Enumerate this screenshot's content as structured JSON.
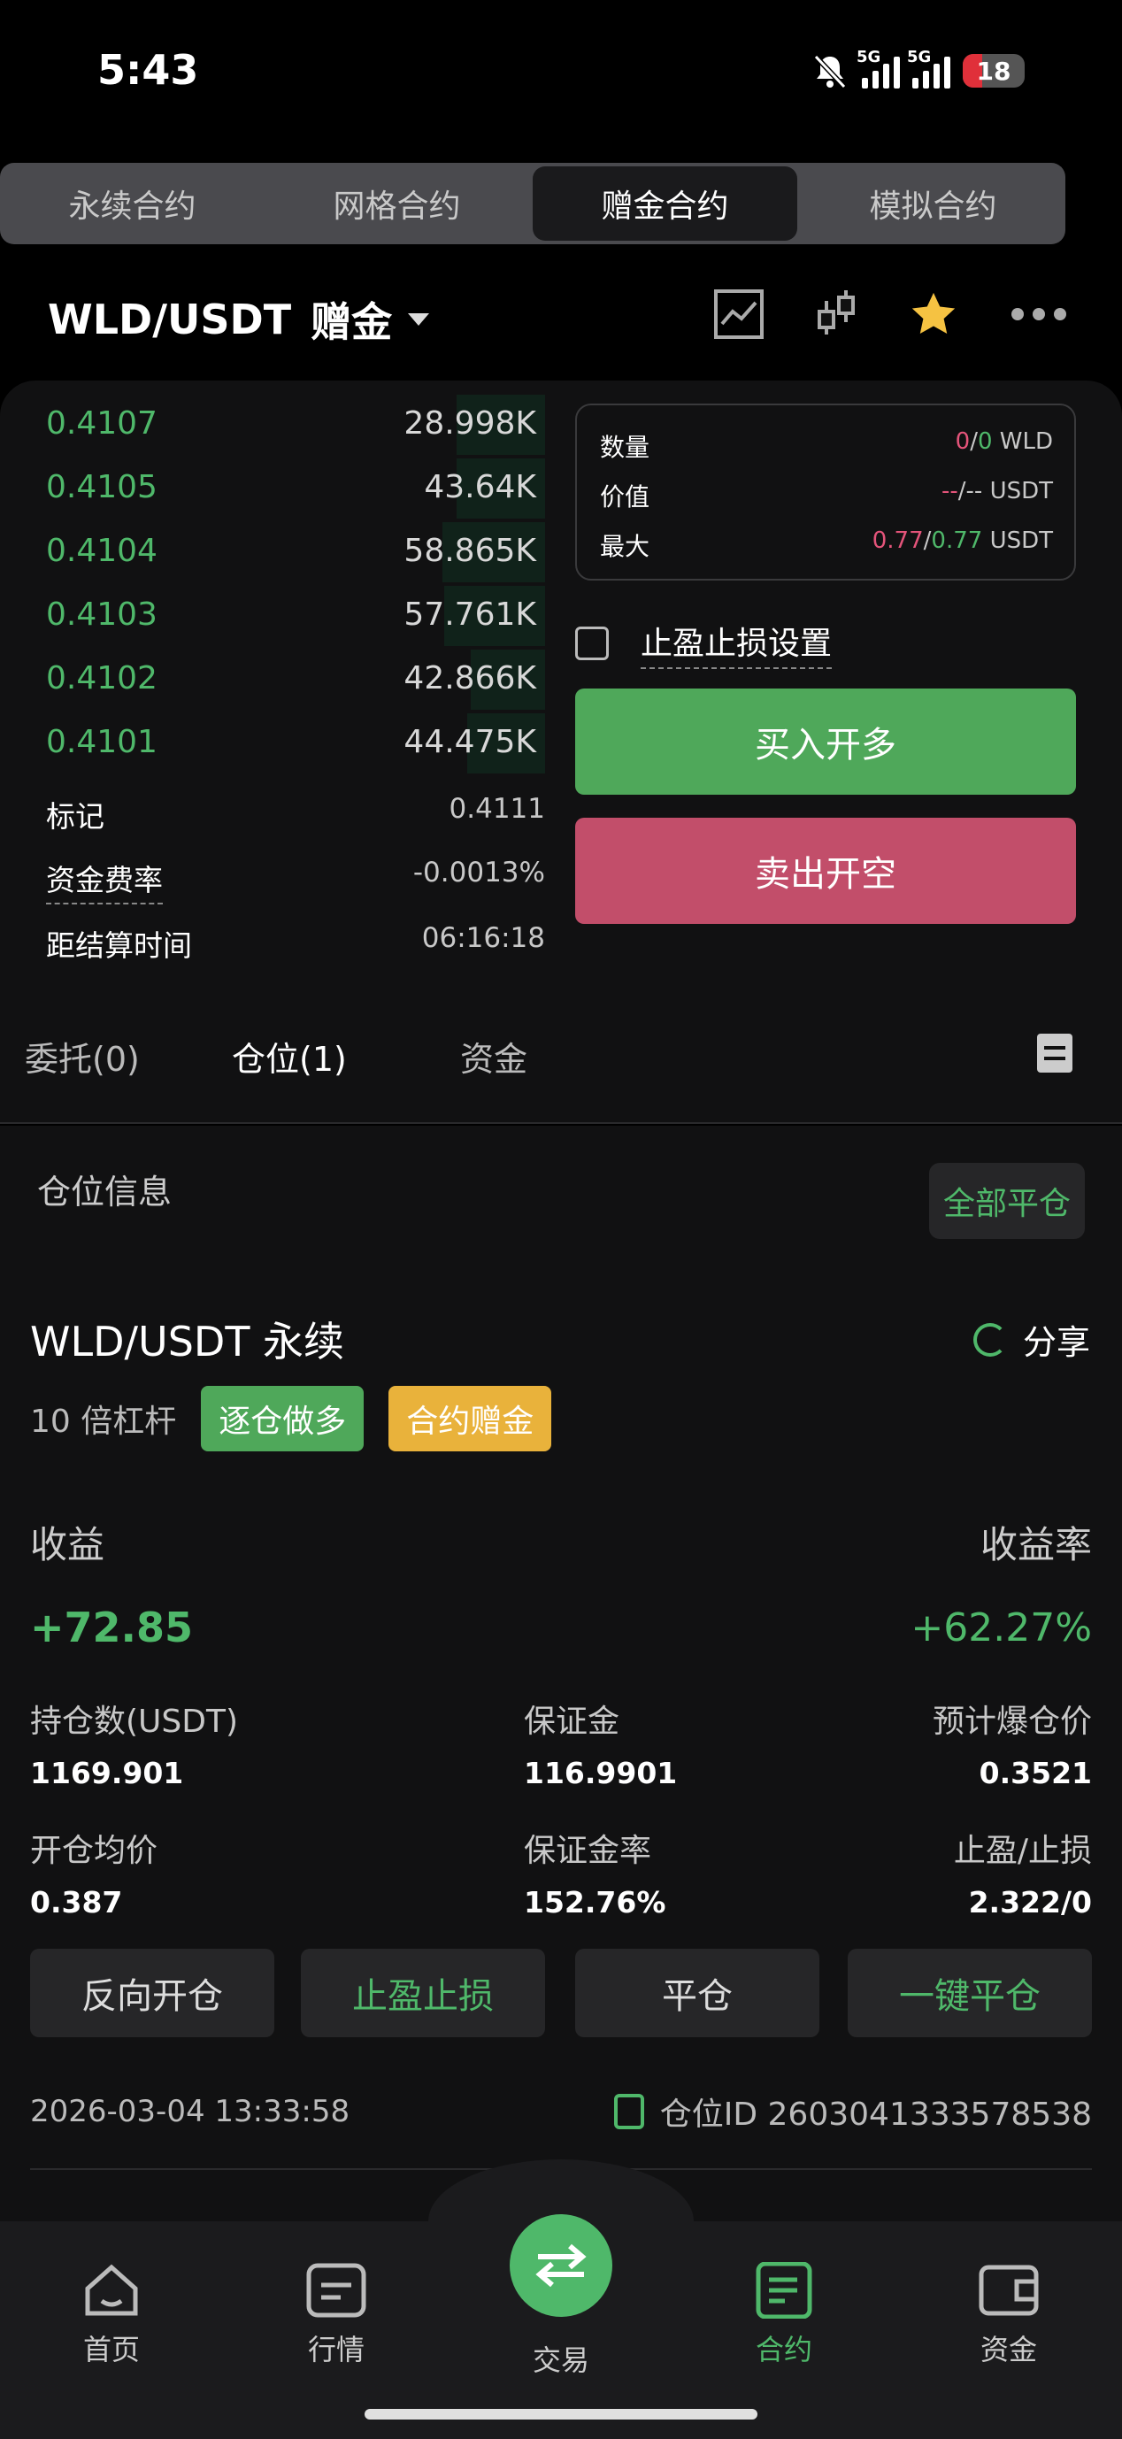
{
  "status": {
    "time": "5:43",
    "battery": "18",
    "net1": "5G",
    "net2": "5G"
  },
  "top_tabs": [
    "永续合约",
    "网格合约",
    "赠金合约",
    "模拟合约"
  ],
  "pair": {
    "symbol": "WLD/USDT",
    "mode": "赠金"
  },
  "orderbook": [
    {
      "price": "0.4107",
      "qty": "28.998K",
      "depth": 0.5
    },
    {
      "price": "0.4105",
      "qty": "43.64K",
      "depth": 0.5
    },
    {
      "price": "0.4104",
      "qty": "58.865K",
      "depth": 0.58
    },
    {
      "price": "0.4103",
      "qty": "57.761K",
      "depth": 0.57
    },
    {
      "price": "0.4102",
      "qty": "42.866K",
      "depth": 0.42
    },
    {
      "price": "0.4101",
      "qty": "44.475K",
      "depth": 0.44
    }
  ],
  "market_info": {
    "mark_label": "标记",
    "mark_value": "0.4111",
    "funding_label": "资金费率",
    "funding_value": "-0.0013%",
    "settle_label": "距结算时间",
    "settle_value": "06:16:18"
  },
  "order_box": {
    "qty_label": "数量",
    "qty_a": "0",
    "qty_sep": "/",
    "qty_b": "0",
    "qty_unit": "WLD",
    "value_label": "价值",
    "value_a": "--",
    "value_sep": "/",
    "value_b": "--",
    "value_unit": "USDT",
    "max_label": "最大",
    "max_a": "0.77",
    "max_sep": "/",
    "max_b": "0.77",
    "max_unit": "USDT"
  },
  "tpsl_setting": "止盈止损设置",
  "buttons": {
    "long": "买入开多",
    "short": "卖出开空"
  },
  "pos_tabs": [
    "委托(0)",
    "仓位(1)",
    "资金"
  ],
  "position_section": {
    "title": "仓位信息",
    "close_all": "全部平仓"
  },
  "position": {
    "name": "WLD/USDT 永续",
    "share": "分享",
    "leverage": "10 倍杠杆",
    "tag_mode": "逐仓做多",
    "tag_bonus": "合约赠金",
    "pnl_label": "收益",
    "pnl_value": "+72.85",
    "rate_label": "收益率",
    "rate_value": "+62.27%",
    "size_label": "持仓数(USDT)",
    "size_value": "1169.901",
    "margin_label": "保证金",
    "margin_value": "116.9901",
    "liq_label": "预计爆仓价",
    "liq_value": "0.3521",
    "entry_label": "开仓均价",
    "entry_value": "0.387",
    "margin_rate_label": "保证金率",
    "margin_rate_value": "152.76%",
    "tpsl_label": "止盈/止损",
    "tpsl_value": "2.322/0",
    "actions": [
      "反向开仓",
      "止盈止损",
      "平仓",
      "一键平仓"
    ],
    "time": "2026-03-04 13:33:58",
    "id_label": "仓位ID 2603041333578538"
  },
  "nav": [
    "首页",
    "行情",
    "交易",
    "合约",
    "资金"
  ],
  "colors": {
    "green": "#4fb86a",
    "red": "#c24e6a",
    "bg": "#111112"
  }
}
